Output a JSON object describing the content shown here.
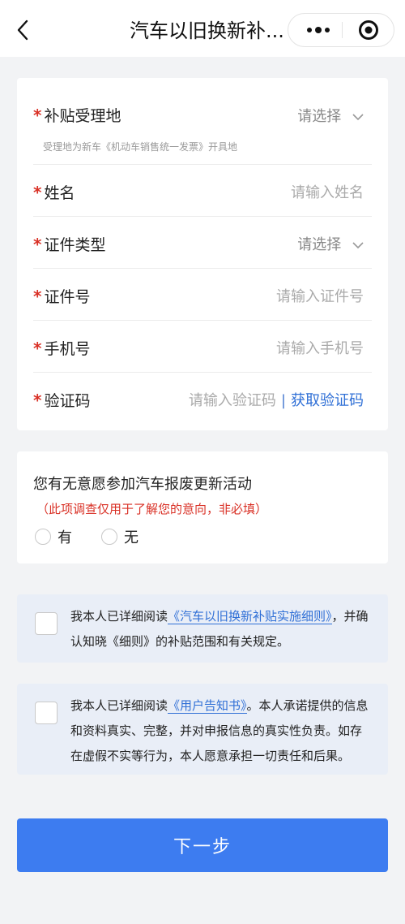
{
  "nav": {
    "title": "汽车以旧换新补...",
    "more_icon": "more-dots-icon",
    "close_icon": "target-circle-icon",
    "back_icon": "chevron-left-icon"
  },
  "form": {
    "fields": [
      {
        "label": "补贴受理地",
        "value": "请选择",
        "type": "select",
        "hint": "受理地为新车《机动车销售统一发票》开具地"
      },
      {
        "label": "姓名",
        "placeholder": "请输入姓名",
        "type": "input"
      },
      {
        "label": "证件类型",
        "value": "请选择",
        "type": "select"
      },
      {
        "label": "证件号",
        "placeholder": "请输入证件号",
        "type": "input"
      },
      {
        "label": "手机号",
        "placeholder": "请输入手机号",
        "type": "input"
      },
      {
        "label": "验证码",
        "placeholder": "请输入验证码",
        "type": "input",
        "action": "获取验证码"
      }
    ],
    "required_mark": "*"
  },
  "survey": {
    "question": "您有无意愿参加汽车报废更新活动",
    "note": "（此项调查仅用于了解您的意向，非必填）",
    "options": [
      "有",
      "无"
    ]
  },
  "agreements": [
    {
      "prefix": "我本人已详细阅读",
      "link": "《汽车以旧换新补贴实施细则》",
      "suffix": "，并确认知晓《细则》的补贴范围和有关规定。"
    },
    {
      "prefix": "我本人已详细阅读",
      "link": "《用户告知书》",
      "suffix": "。本人承诺提供的信息和资料真实、完整，并对申报信息的真实性负责。如存在虚假不实等行为，本人愿意承担一切责任和后果。"
    }
  ],
  "next_button": "下一步",
  "colors": {
    "accent": "#3d7cf0",
    "required": "#d93025",
    "link": "#2f6fd6",
    "agree_bg": "#e9eef7"
  }
}
